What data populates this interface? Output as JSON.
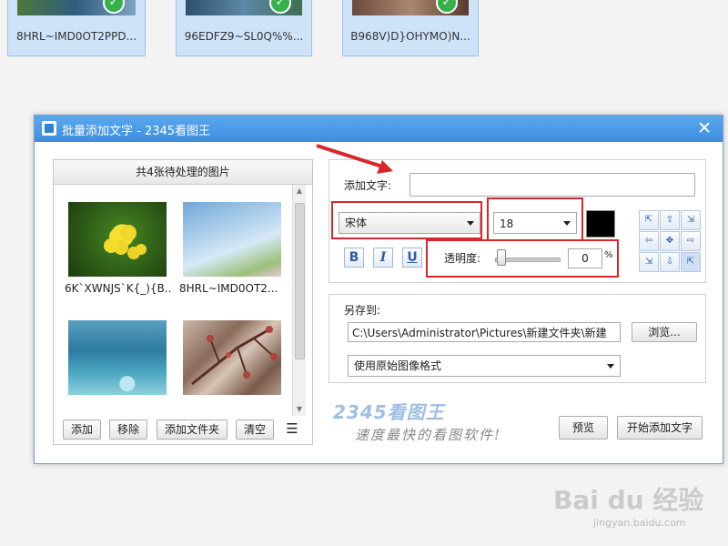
{
  "file_grid": {
    "files": [
      {
        "name": "8HRL~IMD0OT2PPD..."
      },
      {
        "name": "96EDFZ9~SL0Q%%..."
      },
      {
        "name": "B968V)D}OHYMO)N..."
      }
    ],
    "check_glyph": "✓"
  },
  "dialog": {
    "title": "批量添加文字 - 2345看图王",
    "close_glyph": "✕",
    "left_panel": {
      "header": "共4张待处理的图片",
      "images": [
        {
          "caption": "6K`XWNJS`K{_){B..."
        },
        {
          "caption": "8HRL~IMD0OT2..."
        },
        {
          "caption": ""
        },
        {
          "caption": ""
        }
      ],
      "buttons": {
        "add": "添加",
        "remove": "移除",
        "add_folder": "添加文件夹",
        "clear": "清空",
        "menu_glyph": "☰"
      }
    },
    "text_settings": {
      "add_text_label": "添加文字:",
      "add_text_value": "",
      "font": "宋体",
      "size": "18",
      "color": "#000000",
      "bold": "B",
      "italic": "I",
      "underline": "U",
      "opacity_label": "透明度:",
      "opacity_value": "0",
      "opacity_unit": "%"
    },
    "save": {
      "label": "另存到:",
      "path": "C:\\Users\\Administrator\\Pictures\\新建文件夹\\新建",
      "browse": "浏览...",
      "format": "使用原始图像格式"
    },
    "brand": {
      "logo": "2345看图王",
      "slogan": "速度最快的看图软件!"
    },
    "preview_button": "预览",
    "start_button": "开始添加文字"
  },
  "watermark": {
    "text": "Bai du 经验",
    "sub": "jingyan.baidu.com"
  },
  "colors": {
    "titlebar": "#3d8ee0",
    "annotation_red": "#d9262a",
    "selection_blue": "#cfe3f8"
  }
}
